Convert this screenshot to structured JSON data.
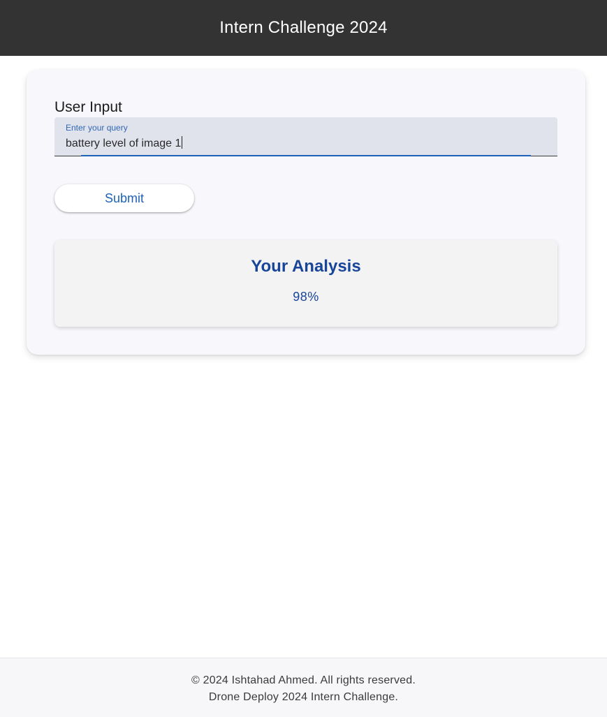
{
  "header": {
    "title": "Intern Challenge 2024",
    "background_color": "#333333"
  },
  "form": {
    "section_heading": "User Input",
    "query_label": "Enter your query",
    "query_value": "battery level of image 1",
    "submit_label": "Submit"
  },
  "result": {
    "title": "Your Analysis",
    "value": "98%",
    "accent_color": "#18459a"
  },
  "footer": {
    "copyright": "© 2024 Ishtahad Ahmed. All rights reserved.",
    "subtitle": "Drone Deploy 2024 Intern Challenge."
  }
}
